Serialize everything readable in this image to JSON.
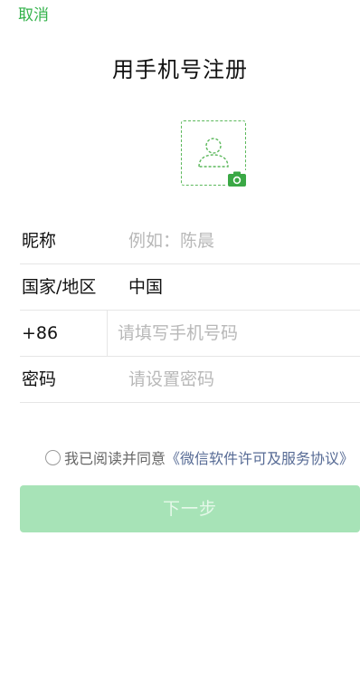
{
  "header": {
    "cancel_label": "取消",
    "title": "用手机号注册"
  },
  "avatar": {
    "person_icon": "person-outline-icon",
    "camera_icon": "camera-icon",
    "accent_color": "#5cb85c"
  },
  "form": {
    "nickname": {
      "label": "昵称",
      "placeholder": "例如：陈晨"
    },
    "region": {
      "label": "国家/地区",
      "value": "中国"
    },
    "phone": {
      "code": "+86",
      "placeholder": "请填写手机号码"
    },
    "password": {
      "label": "密码",
      "placeholder": "请设置密码"
    }
  },
  "agreement": {
    "text": "我已阅读并同意",
    "link": "《微信软件许可及服务协议》",
    "checked": false
  },
  "next_button": {
    "label": "下一步",
    "enabled": false,
    "color": "#a7e3b7"
  },
  "colors": {
    "brand_green": "#33b24a",
    "link_blue": "#576b95",
    "placeholder_gray": "#b8b8b8"
  }
}
